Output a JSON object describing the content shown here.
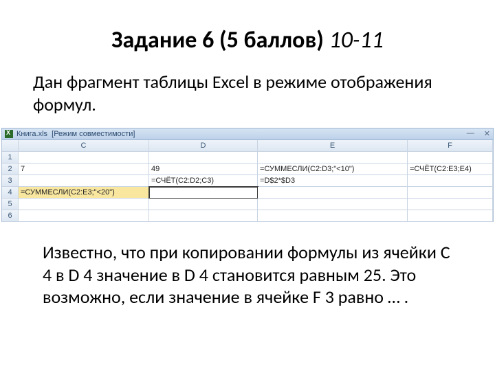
{
  "title_bold": "Задание 6 (5 баллов) ",
  "title_italic": "10-11",
  "intro": "Дан фрагмент таблицы Excel в режиме отображения формул.",
  "titlebar": {
    "filename": "Книга.xls",
    "mode": "[Режим совместимости]",
    "minimize": "—",
    "close": "✕"
  },
  "cols": {
    "c": "C",
    "d": "D",
    "e": "E",
    "f": "F"
  },
  "rows": {
    "r1": "1",
    "r2": "2",
    "r3": "3",
    "r4": "4",
    "r5": "5",
    "r6": "6"
  },
  "cells": {
    "c2": "7",
    "d2": "49",
    "e2": "=СУММЕСЛИ(C2:D3;\"<10\")",
    "f2": "=СЧЁТ(C2:E3;E4)",
    "d3": "=СЧЁТ(C2:D2;C3)",
    "e3": "=D$2*$D3",
    "c4": "=СУММЕСЛИ(C2:E3;\"<20\")"
  },
  "outro": "Известно, что при копировании формулы из ячейки C 4 в D 4 значение в D 4 становится равным 25. Это возможно, если значение в ячейке F 3 равно … ."
}
